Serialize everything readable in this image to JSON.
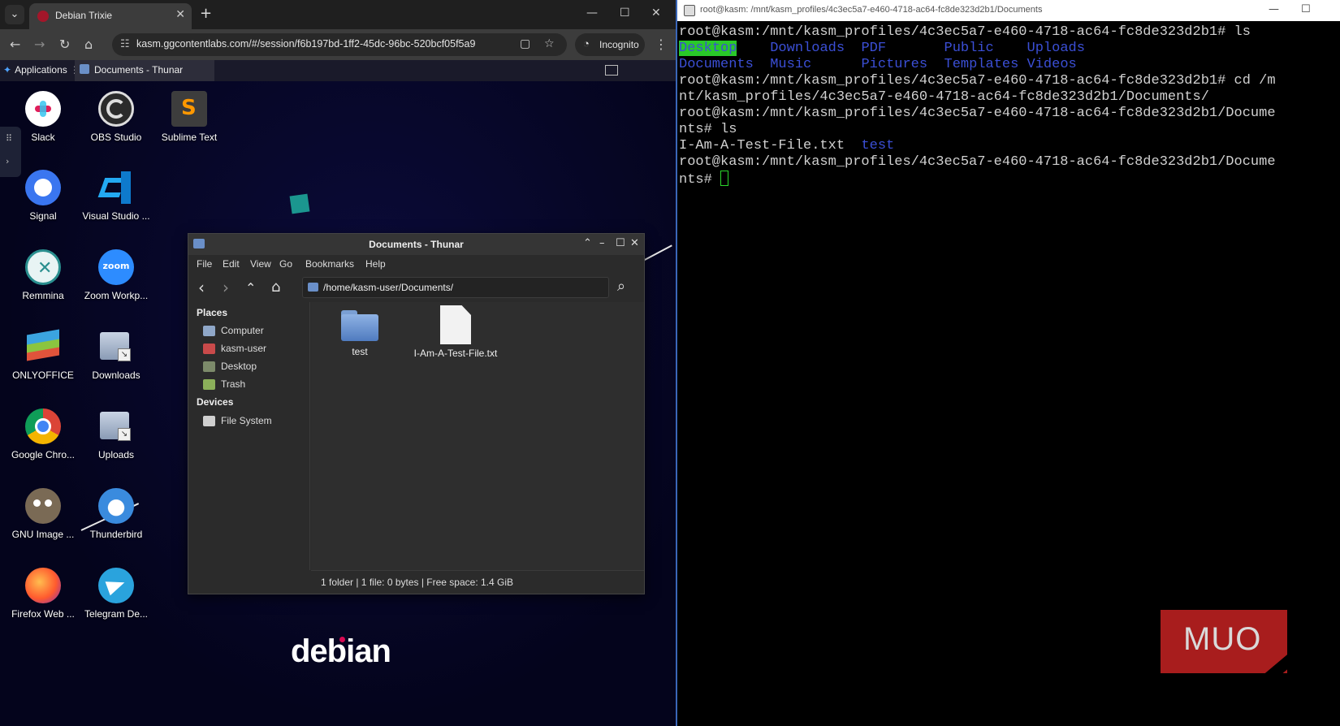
{
  "browser": {
    "tab_title": "Debian Trixie",
    "tab_close": "✕",
    "new_tab": "+",
    "url": "kasm.ggcontentlabs.com/#/session/f6b197bd-1ff2-45dc-96bc-520bcf05f5a9",
    "incognito_label": "Incognito",
    "controls": {
      "minimize": "—",
      "maximize": "☐",
      "close": "✕"
    }
  },
  "panel": {
    "applications": "Applications",
    "task": "Documents - Thunar"
  },
  "desktop": {
    "icons": [
      {
        "label": "Slack",
        "icon": "slack-icon"
      },
      {
        "label": "OBS Studio",
        "icon": "obs-icon"
      },
      {
        "label": "Sublime Text",
        "icon": "sublime-icon"
      },
      {
        "label": "Signal",
        "icon": "signal-icon"
      },
      {
        "label": "Visual Studio ...",
        "icon": "vscode-icon"
      },
      {
        "label": "Remmina",
        "icon": "remmina-icon"
      },
      {
        "label": "Zoom Workp...",
        "icon": "zoom-icon"
      },
      {
        "label": "ONLYOFFICE",
        "icon": "onlyoffice-icon"
      },
      {
        "label": "Downloads",
        "icon": "folder-link-icon"
      },
      {
        "label": "Google Chro...",
        "icon": "chrome-icon"
      },
      {
        "label": "Uploads",
        "icon": "folder-link-icon"
      },
      {
        "label": "GNU Image ...",
        "icon": "gimp-icon"
      },
      {
        "label": "Thunderbird",
        "icon": "thunderbird-icon"
      },
      {
        "label": "Firefox Web ...",
        "icon": "firefox-icon"
      },
      {
        "label": "Telegram De...",
        "icon": "telegram-icon"
      }
    ],
    "zoom_text": "zoom",
    "wallpaper_logo": "debian"
  },
  "thunar": {
    "title": "Documents - Thunar",
    "menu": [
      "File",
      "Edit",
      "View",
      "Go",
      "Bookmarks",
      "Help"
    ],
    "path": "/home/kasm-user/Documents/",
    "places_header": "Places",
    "places": [
      "Computer",
      "kasm-user",
      "Desktop",
      "Trash"
    ],
    "devices_header": "Devices",
    "devices": [
      "File System"
    ],
    "files": [
      {
        "name": "test",
        "type": "folder"
      },
      {
        "name": "I-Am-A-Test-File.txt",
        "type": "file"
      }
    ],
    "status": "1 folder  |  1 file: 0 bytes  |  Free space: 1.4 GiB"
  },
  "terminal": {
    "title": "root@kasm: /mnt/kasm_profiles/4c3ec5a7-e460-4718-ac64-fc8de323d2b1/Documents",
    "lines": {
      "l1": "root@kasm:/mnt/kasm_profiles/4c3ec5a7-e460-4718-ac64-fc8de323d2b1# ls",
      "l4": "root@kasm:/mnt/kasm_profiles/4c3ec5a7-e460-4718-ac64-fc8de323d2b1# cd /m",
      "l5": "nt/kasm_profiles/4c3ec5a7-e460-4718-ac64-fc8de323d2b1/Documents/",
      "l6": "root@kasm:/mnt/kasm_profiles/4c3ec5a7-e460-4718-ac64-fc8de323d2b1/Docume",
      "l7": "nts# ls",
      "l8_file": "I-Am-A-Test-File.txt",
      "l8_dir": "test",
      "l9": "root@kasm:/mnt/kasm_profiles/4c3ec5a7-e460-4718-ac64-fc8de323d2b1/Docume",
      "l10": "nts# "
    },
    "ls_row1": [
      "Desktop",
      "Downloads",
      "PDF",
      "Public",
      "Uploads"
    ],
    "ls_row2": [
      "Documents",
      "Music",
      "Pictures",
      "Templates",
      "Videos"
    ]
  },
  "watermark": "MUO",
  "colors": {
    "terminal_dir": "#3b4fd6",
    "terminal_highlight": "#29c929",
    "debian_red": "#d70a53",
    "muo_red": "#a81d1d"
  }
}
